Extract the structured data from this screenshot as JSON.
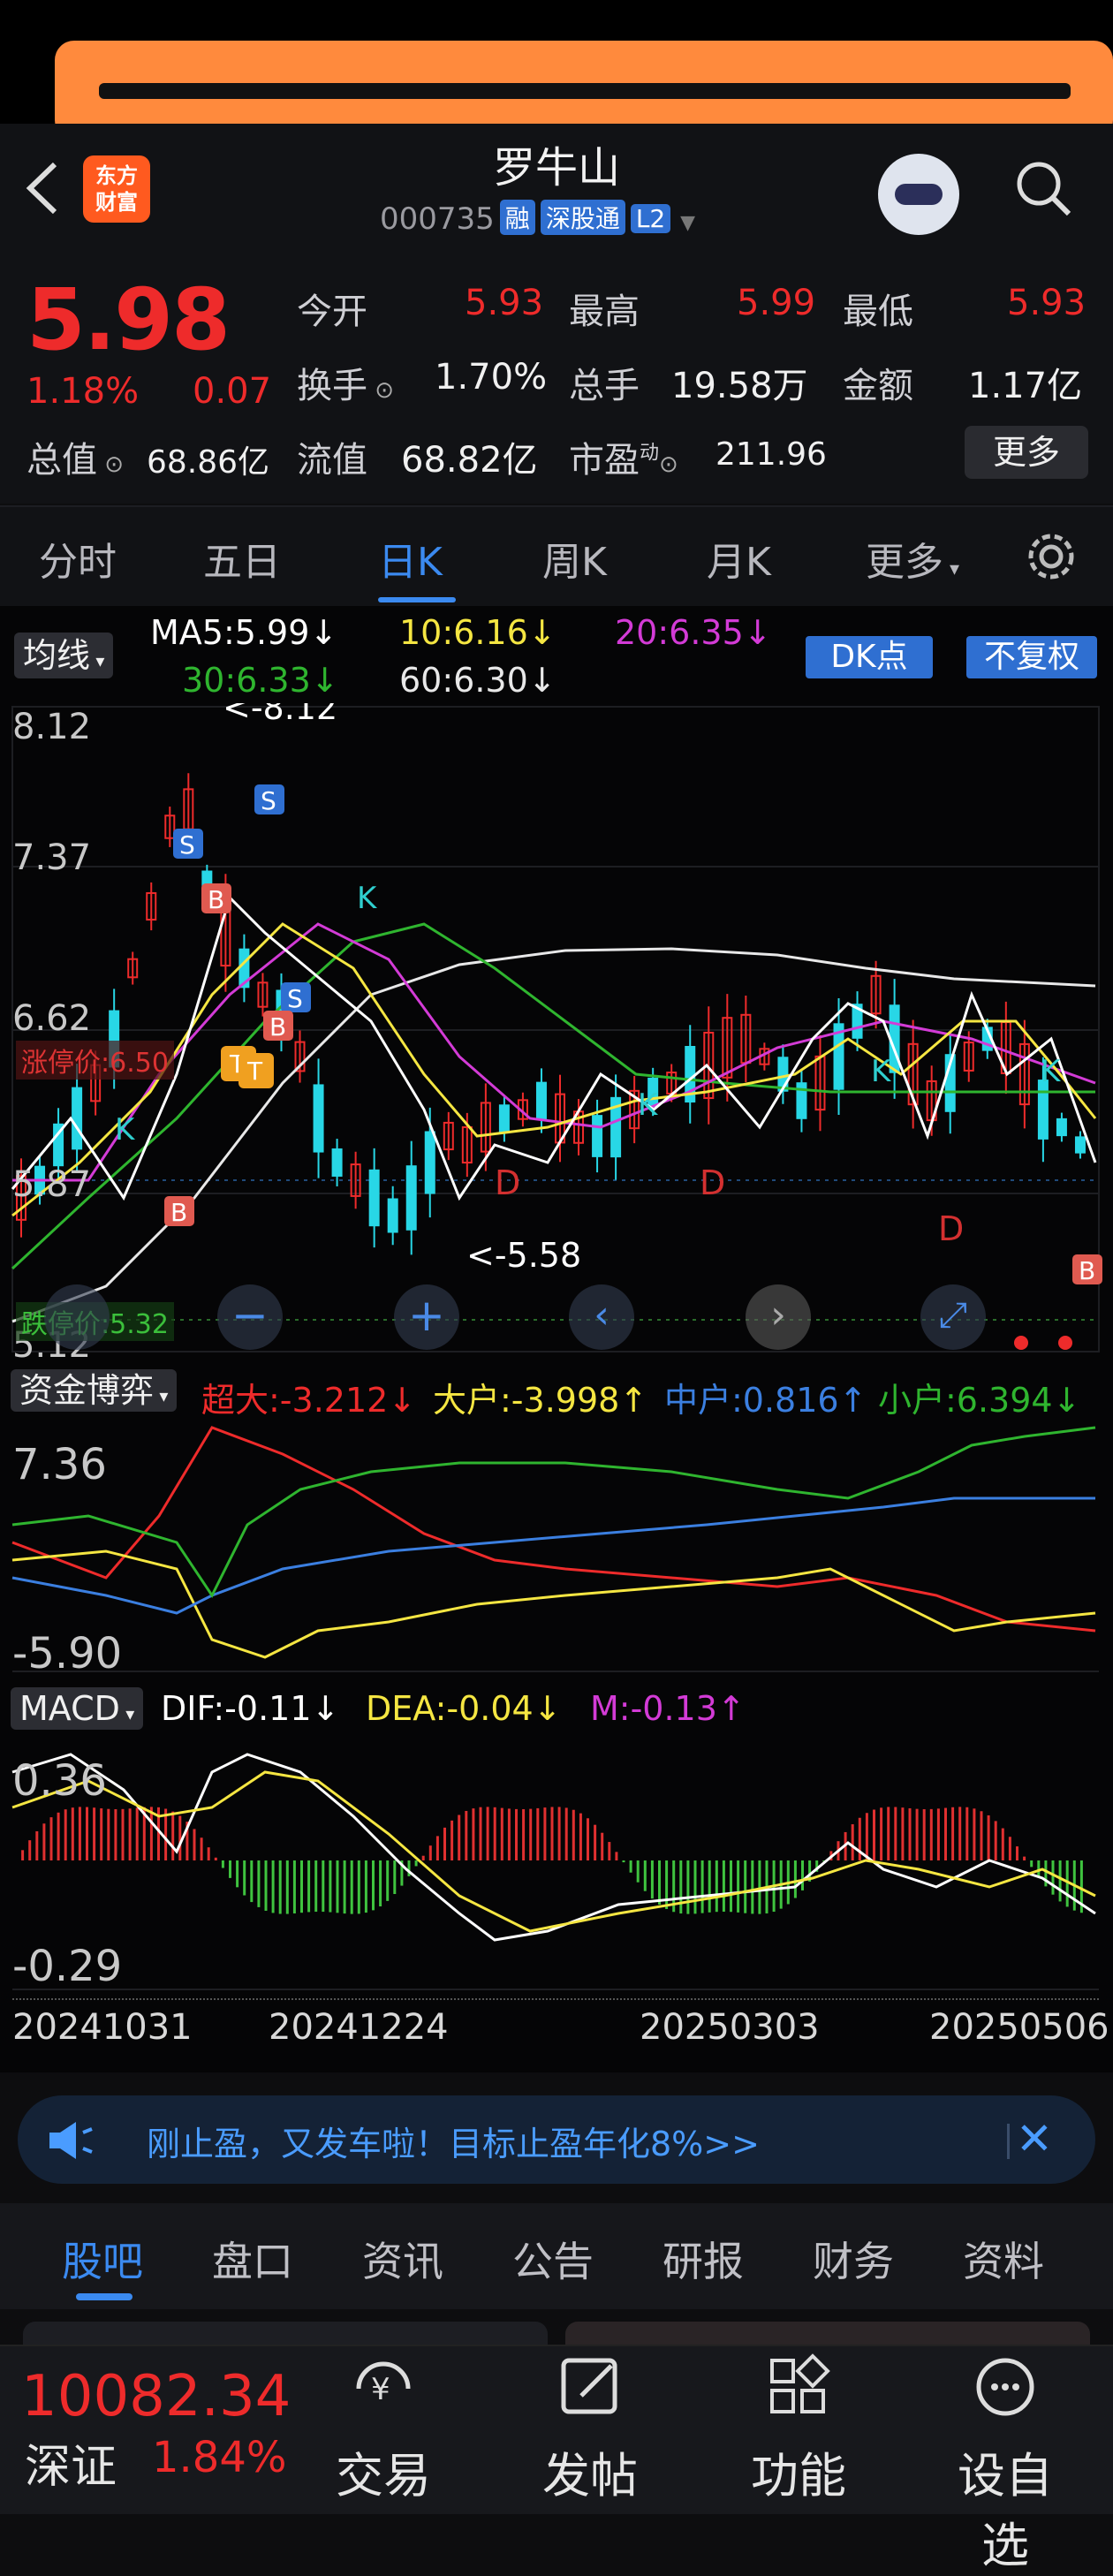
{
  "header": {
    "stock_name": "罗牛山",
    "code": "000735",
    "tags": [
      "融",
      "深股通",
      "L2"
    ],
    "logo_text": "东方\n财富"
  },
  "quote": {
    "price": "5.98",
    "change_pct": "1.18%",
    "change": "0.07",
    "open_label": "今开",
    "open": "5.93",
    "high_label": "最高",
    "high": "5.99",
    "low_label": "最低",
    "low": "5.93",
    "turnover_label": "换手",
    "turnover": "1.70%",
    "volume_label": "总手",
    "volume": "19.58万",
    "amount_label": "金额",
    "amount": "1.17亿",
    "mktcap_label": "总值",
    "mktcap": "68.86亿",
    "float_label": "流值",
    "float": "68.82亿",
    "pe_label": "市盈",
    "pe_sup": "动",
    "pe": "211.96",
    "more_label": "更多"
  },
  "tabs": [
    "分时",
    "五日",
    "日K",
    "周K",
    "月K",
    "更多"
  ],
  "active_tab": "日K",
  "ma": {
    "selector": "均线",
    "ma5": "MA5:5.99↓",
    "ma10": "10:6.16↓",
    "ma20": "20:6.35↓",
    "ma30": "30:6.33↓",
    "ma60": "60:6.30↓",
    "dk": "DK点",
    "fq": "不复权"
  },
  "kline": {
    "y_top": "8.12",
    "y_2": "7.37",
    "y_3": "6.62",
    "y_4": "5.87",
    "y_bottom": "5.12",
    "high_mark": "<-8.12",
    "low_mark": "<-5.58",
    "limit_up": "涨停价:6.50",
    "limit_down": "跌停价:5.32"
  },
  "flow": {
    "selector": "资金博弈",
    "super": "超大:-3.212↓",
    "large": "大户:-3.998↑",
    "mid": "中户:0.816↑",
    "small": "小户:6.394↓",
    "y_top": "7.36",
    "y_bottom": "-5.90"
  },
  "macd": {
    "selector": "MACD",
    "dif": "DIF:-0.11↓",
    "dea": "DEA:-0.04↓",
    "m": "M:-0.13↑",
    "y_top": "0.36",
    "y_bottom": "-0.29"
  },
  "dates": [
    "20241031",
    "20241224",
    "20250303",
    "20250506"
  ],
  "banner": {
    "text": "刚止盈，又发车啦！目标止盈年化8%>>"
  },
  "subtabs": [
    "股吧",
    "盘口",
    "资讯",
    "公告",
    "研报",
    "财务",
    "资料"
  ],
  "nav": {
    "index_value": "10082.34",
    "index_name": "深证",
    "index_pct": "1.84%",
    "items": [
      "交易",
      "发帖",
      "功能",
      "设自选"
    ]
  },
  "colors": {
    "up": "#ee2b2b",
    "accent": "#3b8af0",
    "ma5": "#ffffff",
    "ma10": "#f5e642",
    "ma20": "#d33bd6",
    "ma30": "#2fb52f",
    "ma60": "#e8e8e8"
  }
}
